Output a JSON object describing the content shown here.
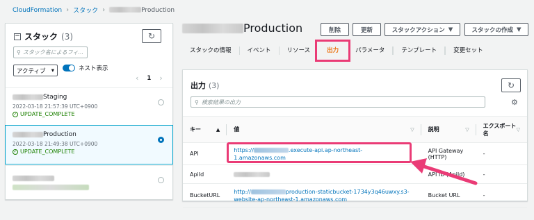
{
  "breadcrumb": {
    "root": "CloudFormation",
    "stacks": "スタック",
    "current_suffix": "Production"
  },
  "sidebar": {
    "title": "スタック",
    "count": "(3)",
    "search_placeholder": "スタック名によるフィ...",
    "filter_value": "アクティブ",
    "nested_label": "ネスト表示",
    "page": "1",
    "stacks": [
      {
        "name_suffix": "Staging",
        "time": "2022-03-18 21:57:39 UTC+0900",
        "status": "UPDATE_COMPLETE",
        "selected": false
      },
      {
        "name_suffix": "Production",
        "time": "2022-03-18 21:49:38 UTC+0900",
        "status": "UPDATE_COMPLETE",
        "selected": true
      },
      {
        "name_suffix": "",
        "time": "",
        "status": "",
        "selected": false
      }
    ]
  },
  "header": {
    "title_suffix": "Production",
    "buttons": {
      "delete": "削除",
      "update": "更新",
      "stack_actions": "スタックアクション",
      "create_stack": "スタックの作成"
    }
  },
  "tabs": [
    "スタックの情報",
    "イベント",
    "リソース",
    "出力",
    "パラメータ",
    "テンプレート",
    "変更セット"
  ],
  "active_tab": "出力",
  "outputs": {
    "title": "出力",
    "count": "(3)",
    "search_placeholder": "検索結果の出力",
    "columns": {
      "key": "キー",
      "value": "値",
      "description": "説明",
      "export": "エクスポート名"
    },
    "rows": [
      {
        "key": "API",
        "value_prefix": "https://",
        "value_suffix": ".execute-api.ap-northeast-1.amazonaws.com",
        "description": "API Gateway (HTTP)",
        "export": "-"
      },
      {
        "key": "ApiId",
        "value_prefix": "",
        "value_suffix": "",
        "description": "API ID (ApiId)",
        "export": "-"
      },
      {
        "key": "BucketURL",
        "value_prefix": "http://",
        "value_suffix": "production-staticbucket-1734y3q46uwxy.s3-website-ap-northeast-1.amazonaws.com",
        "description": "Bucket URL",
        "export": "-"
      }
    ]
  },
  "colors": {
    "accent": "#ec7211",
    "link": "#0073bb",
    "highlight": "#ea3b76",
    "success": "#1d8102"
  }
}
